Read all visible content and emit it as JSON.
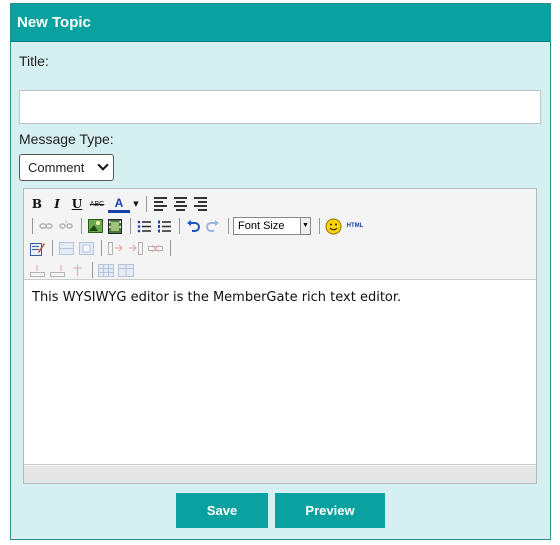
{
  "panel": {
    "title": "New Topic",
    "title_label": "Title:",
    "title_value": "",
    "message_type_label": "Message Type:",
    "message_type_selected": "Comment"
  },
  "editor": {
    "toolbar": {
      "bold": "B",
      "italic": "I",
      "underline": "U",
      "strikethrough": "ABC",
      "font_color": "A",
      "font_size_label": "Font Size",
      "html_label": "HTML"
    },
    "content": "This WYSIWYG editor is the MemberGate rich text editor."
  },
  "buttons": {
    "save": "Save",
    "preview": "Preview"
  },
  "colors": {
    "accent": "#0aa2a0",
    "panel_bg": "#d6eff0"
  }
}
